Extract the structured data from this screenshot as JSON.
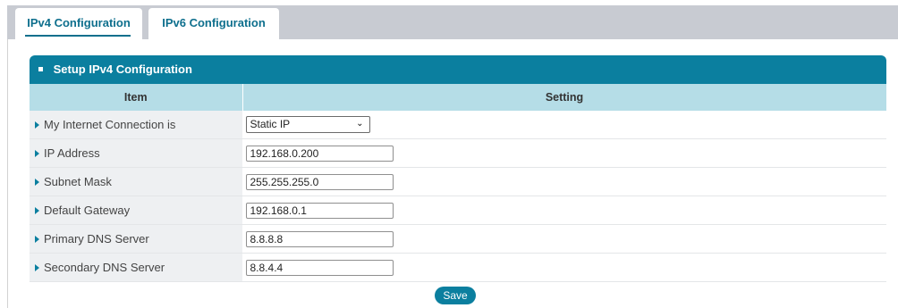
{
  "tabs": [
    {
      "label": "IPv4 Configuration",
      "active": true
    },
    {
      "label": "IPv6 Configuration",
      "active": false
    }
  ],
  "panel": {
    "title": "Setup IPv4 Configuration",
    "columns": {
      "item": "Item",
      "setting": "Setting"
    },
    "rows": [
      {
        "label": "My Internet Connection is",
        "type": "select",
        "value": "Static IP"
      },
      {
        "label": "IP Address",
        "type": "text",
        "value": "192.168.0.200"
      },
      {
        "label": "Subnet Mask",
        "type": "text",
        "value": "255.255.255.0"
      },
      {
        "label": "Default Gateway",
        "type": "text",
        "value": "192.168.0.1"
      },
      {
        "label": "Primary DNS Server",
        "type": "text",
        "value": "8.8.8.8"
      },
      {
        "label": "Secondary DNS Server",
        "type": "text",
        "value": "8.8.4.4"
      }
    ]
  },
  "save_label": "Save",
  "colors": {
    "accent": "#0b7f9f",
    "header_row": "#b5dde7",
    "tab_bar": "#c8cbd2"
  }
}
